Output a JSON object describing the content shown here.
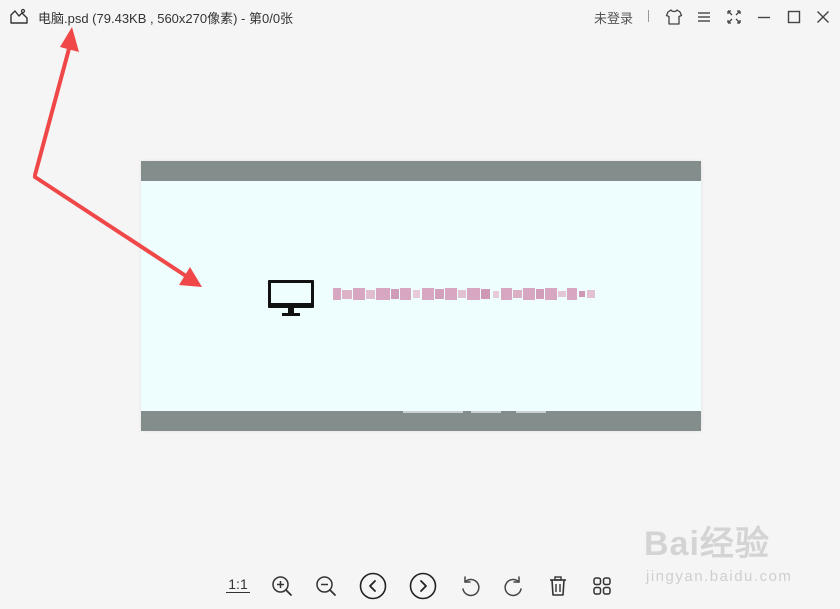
{
  "titlebar": {
    "title": "电脑.psd (79.43KB , 560x270像素) - 第0/0张",
    "login_label": "未登录",
    "icons": [
      "app-icon",
      "skin-icon",
      "menu-icon",
      "fullscreen-icon",
      "minimize-icon",
      "maximize-icon",
      "close-icon"
    ]
  },
  "preview": {
    "band_color": "#838d8c",
    "background_color": "#eefefe",
    "monitor_icon": "monitor-icon"
  },
  "toolbar": {
    "actual_size_label": "1:1",
    "buttons": [
      "zoom-in-icon",
      "zoom-out-icon",
      "previous-icon",
      "next-icon",
      "rotate-left-icon",
      "rotate-right-icon",
      "delete-icon",
      "thumbnails-icon"
    ]
  },
  "watermark": {
    "logo": "Bai经验",
    "url": "jingyan.baidu.com"
  },
  "colors": {
    "arrow": "#f04848",
    "background": "#f5f5f5",
    "icon": "#333333"
  }
}
